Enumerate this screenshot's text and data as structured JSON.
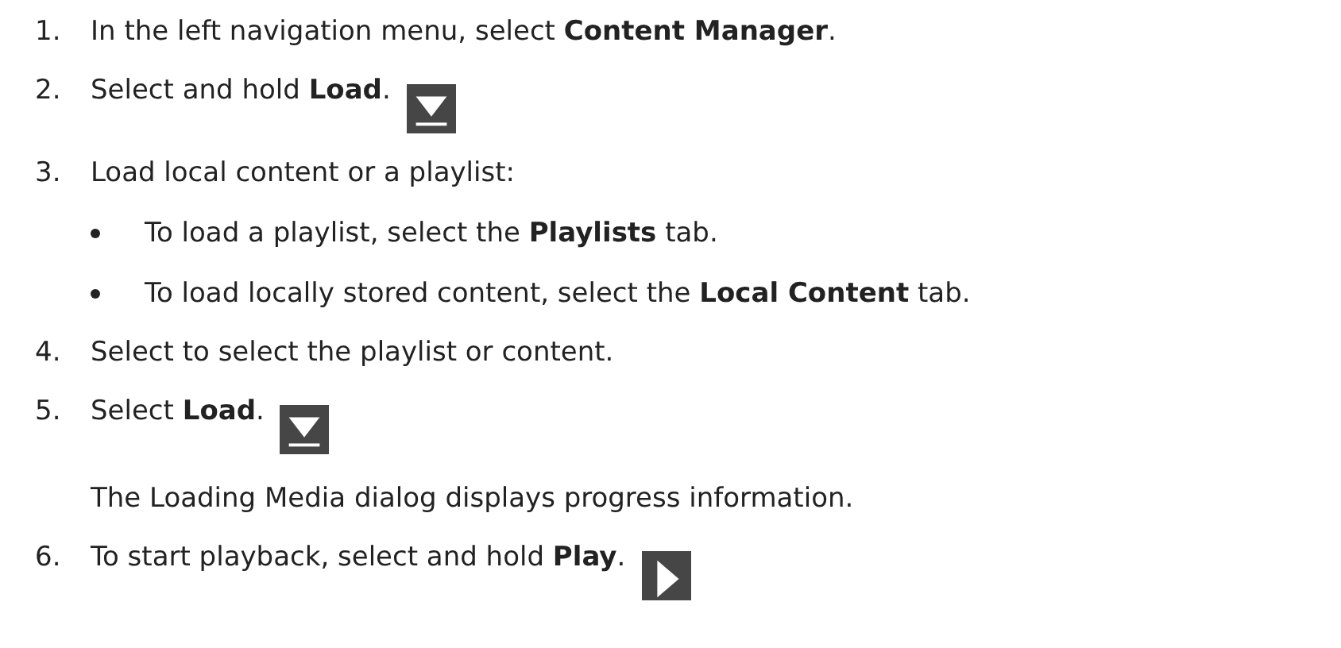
{
  "steps": [
    {
      "number": "1.",
      "text": "In the left navigation menu, select **Content Manager**.",
      "kind": "plain"
    },
    {
      "number": "2.",
      "text": "Select and hold **Load**.",
      "kind": "load"
    },
    {
      "number": "3.",
      "text": "Load local content or a playlist:",
      "kind": "plain",
      "bullets": [
        "To load a playlist, select the **Playlists** tab.",
        "To load locally stored content, select the **Local Content** tab."
      ]
    },
    {
      "number": "4.",
      "text": "Select to select the playlist or content.",
      "kind": "plain"
    },
    {
      "number": "5.",
      "text": "Select **Load**.",
      "kind": "load",
      "note": "The Loading Media dialog displays progress information."
    },
    {
      "number": "6.",
      "text": "To start playback, select and hold **Play**.",
      "kind": "play"
    }
  ]
}
